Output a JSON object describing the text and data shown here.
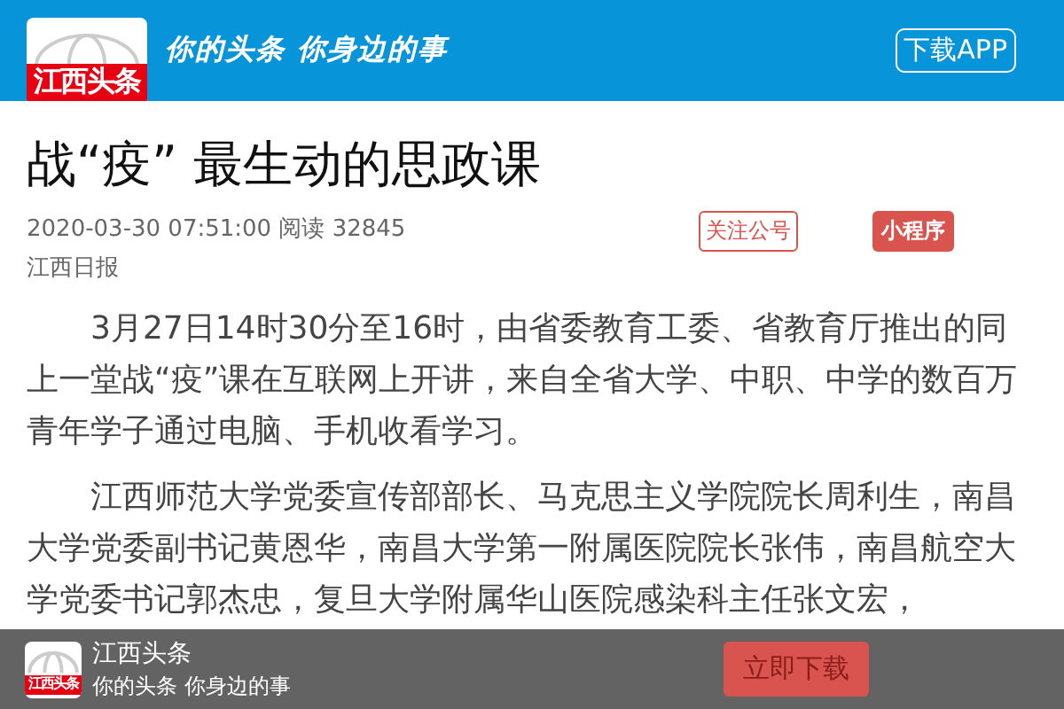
{
  "header": {
    "logo_text": "江西头条",
    "slogan": "你的头条 你身边的事",
    "download_button": "下载APP"
  },
  "article": {
    "title": "战“疫” 最生动的思政课",
    "meta": "2020-03-30 07:51:00 阅读 32845",
    "source": "江西日报",
    "follow_button": "关注公号",
    "mini_program_button": "小程序",
    "paragraphs": [
      "3月27日14时30分至16时，由省委教育工委、省教育厅推出的同上一堂战“疫”课在互联网上开讲，来自全省大学、中职、中学的数百万青年学子通过电脑、手机收看学习。",
      "江西师范大学党委宣传部部长、马克思主义学院院长周利生，南昌大学党委副书记黄恩华，南昌大学第一附属医院院长张伟，南昌航空大学党委书记郭杰忠，复旦大学附属华山医院感染科主任张文宏，"
    ]
  },
  "banner": {
    "logo_text": "江西头条",
    "title": "江西头条",
    "subtitle": "你的头条 你身边的事",
    "download_button": "立即下载"
  }
}
